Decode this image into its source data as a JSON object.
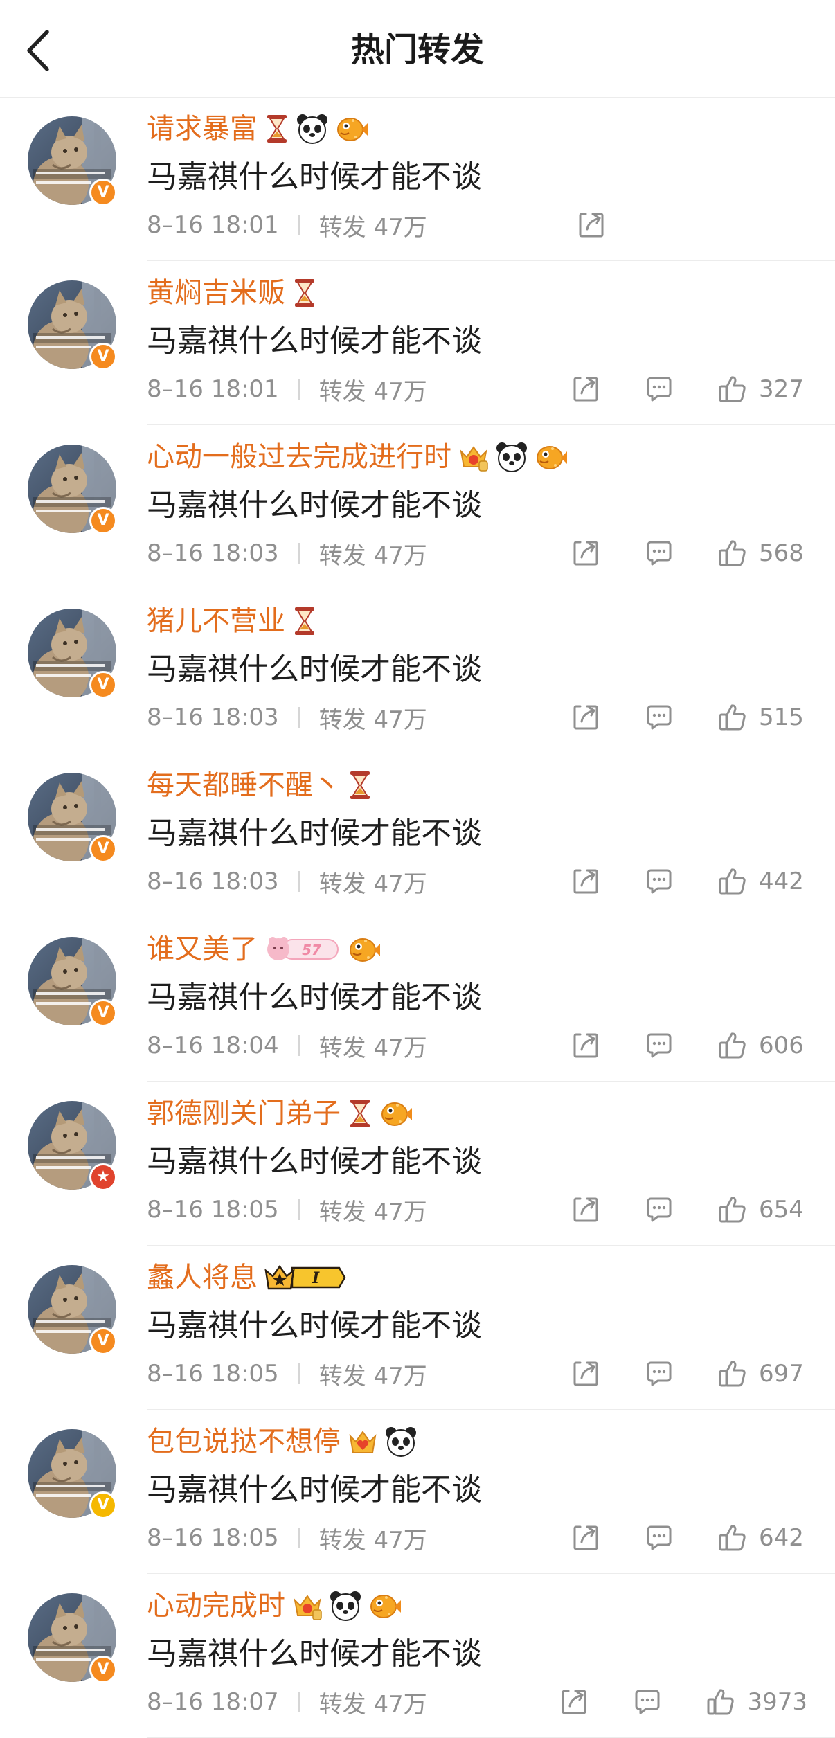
{
  "header": {
    "title": "热门转发",
    "back_icon": "chevron-left-icon"
  },
  "colors": {
    "username": "#e36d1d",
    "text": "#1e1e1e",
    "meta": "#8f8f8f",
    "verified_orange": "#f58a1f",
    "verified_yellow": "#f5b800",
    "badge_red": "#e0432d"
  },
  "reposts": [
    {
      "username": "请求暴富",
      "emblems": [
        "hourglass-icon",
        "panda-icon",
        "pufferfish-icon"
      ],
      "badge": "verified-orange",
      "content": "马嘉祺什么时候才能不谈",
      "time": "8–16 18:01",
      "repost_label": "转发 47万",
      "likes": "",
      "show_comment": false
    },
    {
      "username": "黄焖吉米贩",
      "emblems": [
        "hourglass-icon"
      ],
      "badge": "verified-orange",
      "content": "马嘉祺什么时候才能不谈",
      "time": "8–16 18:01",
      "repost_label": "转发 47万",
      "likes": "327",
      "show_comment": true
    },
    {
      "username": "心动一般过去完成进行时",
      "emblems": [
        "crown-level-icon",
        "panda-icon",
        "pufferfish-icon"
      ],
      "badge": "verified-orange",
      "content": "马嘉祺什么时候才能不谈",
      "time": "8–16 18:03",
      "repost_label": "转发 47万",
      "likes": "568",
      "show_comment": true
    },
    {
      "username": "猪儿不营业",
      "emblems": [
        "hourglass-icon"
      ],
      "badge": "verified-orange",
      "content": "马嘉祺什么时候才能不谈",
      "time": "8–16 18:03",
      "repost_label": "转发 47万",
      "likes": "515",
      "show_comment": true
    },
    {
      "username": "每天都睡不醒丶",
      "emblems": [
        "hourglass-icon"
      ],
      "badge": "verified-orange",
      "content": "马嘉祺什么时候才能不谈",
      "time": "8–16 18:03",
      "repost_label": "转发 47万",
      "likes": "442",
      "show_comment": true
    },
    {
      "username": "谁又美了",
      "emblems": [
        "pink-level-badge-icon",
        "pufferfish-icon"
      ],
      "badge": "verified-orange",
      "content": "马嘉祺什么时候才能不谈",
      "time": "8–16 18:04",
      "repost_label": "转发 47万",
      "likes": "606",
      "show_comment": true
    },
    {
      "username": "郭德刚关门弟子",
      "emblems": [
        "hourglass-icon",
        "pufferfish-icon"
      ],
      "badge": "star-red",
      "content": "马嘉祺什么时候才能不谈",
      "time": "8–16 18:05",
      "repost_label": "转发 47万",
      "likes": "654",
      "show_comment": true
    },
    {
      "username": "蠡人将息",
      "emblems": [
        "crown-vip-level-icon"
      ],
      "badge": "verified-orange",
      "content": "马嘉祺什么时候才能不谈",
      "time": "8–16 18:05",
      "repost_label": "转发 47万",
      "likes": "697",
      "show_comment": true
    },
    {
      "username": "包包说挞不想停",
      "emblems": [
        "crown-heart-icon",
        "panda-icon"
      ],
      "badge": "verified-yellow",
      "content": "马嘉祺什么时候才能不谈",
      "time": "8–16 18:05",
      "repost_label": "转发 47万",
      "likes": "642",
      "show_comment": true
    },
    {
      "username": "心动完成时",
      "emblems": [
        "crown-level-icon",
        "panda-icon",
        "pufferfish-icon"
      ],
      "badge": "verified-orange",
      "content": "马嘉祺什么时候才能不谈",
      "time": "8–16 18:07",
      "repost_label": "转发 47万",
      "likes": "3973",
      "show_comment": true
    }
  ]
}
